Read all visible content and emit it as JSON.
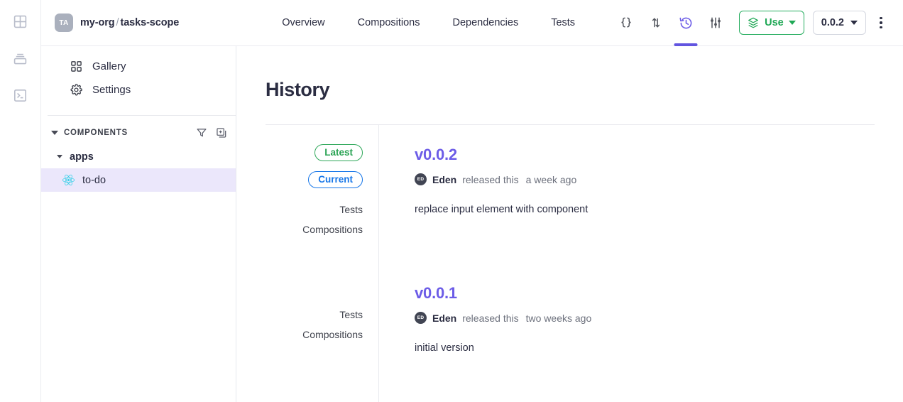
{
  "rail": {
    "items": [
      {
        "icon": "grid-workspace-icon",
        "name": "workspace"
      },
      {
        "icon": "scopes-stack-icon",
        "name": "scopes"
      },
      {
        "icon": "terminal-icon",
        "name": "terminal"
      }
    ]
  },
  "topbar": {
    "scope": {
      "avatar_initials": "TA",
      "org": "my-org",
      "separator": "/",
      "name": "tasks-scope"
    },
    "tabs": [
      {
        "label": "Overview",
        "active": false
      },
      {
        "label": "Compositions",
        "active": false
      },
      {
        "label": "Dependencies",
        "active": false
      },
      {
        "label": "Tests",
        "active": false
      }
    ],
    "icon_actions": [
      {
        "name": "code-braces-icon",
        "label": "{ }",
        "active": false
      },
      {
        "name": "compare-changes-icon",
        "label": "compare",
        "active": false
      },
      {
        "name": "history-clock-icon",
        "label": "history",
        "active": true
      },
      {
        "name": "sliders-settings-icon",
        "label": "configuration",
        "active": false
      }
    ],
    "use_button": {
      "label": "Use",
      "icon": "package-box-icon",
      "color": "#1fa855"
    },
    "version_select": {
      "value": "0.0.2"
    },
    "more_menu": {
      "name": "kebab-menu"
    }
  },
  "sidebar": {
    "links": [
      {
        "label": "Gallery",
        "icon": "gallery-grid-icon"
      },
      {
        "label": "Settings",
        "icon": "gear-icon"
      }
    ],
    "section": {
      "title": "COMPONENTS",
      "actions": [
        {
          "name": "filter-funnel-icon"
        },
        {
          "name": "add-component-icon"
        }
      ]
    },
    "tree": [
      {
        "label": "apps",
        "type": "group",
        "expanded": true
      },
      {
        "label": "to-do",
        "type": "component",
        "icon": "react-icon",
        "selected": true
      }
    ]
  },
  "content": {
    "title": "History",
    "releases": [
      {
        "badges": [
          {
            "label": "Latest",
            "kind": "latest"
          },
          {
            "label": "Current",
            "kind": "current"
          }
        ],
        "meta_labels": [
          "Tests",
          "Compositions"
        ],
        "version": "v0.0.2",
        "author_initials": "ED",
        "author": "Eden",
        "action_text": "released this",
        "time": "a week ago",
        "message": "replace input element with component"
      },
      {
        "badges": [],
        "meta_labels": [
          "Tests",
          "Compositions"
        ],
        "version": "v0.0.1",
        "author_initials": "ED",
        "author": "Eden",
        "action_text": "released this",
        "time": "two weeks ago",
        "message": "initial version"
      }
    ]
  },
  "colors": {
    "accent_purple": "#6c5ce7",
    "green": "#27ae60",
    "blue": "#1877e8",
    "selected_row": "#ebe7fb",
    "react_cyan": "#32d0e8"
  }
}
